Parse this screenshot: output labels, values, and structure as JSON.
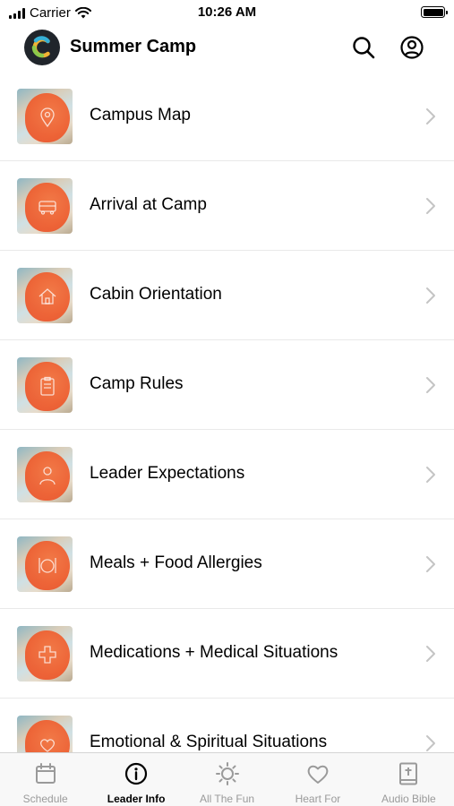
{
  "status_bar": {
    "carrier": "Carrier",
    "time": "10:26 AM"
  },
  "header": {
    "title": "Summer Camp",
    "search_icon": "search-icon",
    "profile_icon": "profile-icon"
  },
  "list": [
    {
      "label": "Campus Map",
      "icon": "map-pin-icon"
    },
    {
      "label": "Arrival at Camp",
      "icon": "bus-icon"
    },
    {
      "label": "Cabin Orientation",
      "icon": "house-icon"
    },
    {
      "label": "Camp Rules",
      "icon": "clipboard-icon"
    },
    {
      "label": "Leader Expectations",
      "icon": "person-icon"
    },
    {
      "label": "Meals + Food Allergies",
      "icon": "utensils-icon"
    },
    {
      "label": "Medications + Medical Situations",
      "icon": "medical-cross-icon"
    },
    {
      "label": "Emotional & Spiritual Situations",
      "icon": "heart-hands-icon"
    }
  ],
  "tabs": [
    {
      "label": "Schedule",
      "icon": "calendar-icon",
      "active": false
    },
    {
      "label": "Leader Info",
      "icon": "info-icon",
      "active": true
    },
    {
      "label": "All The Fun",
      "icon": "sun-icon",
      "active": false
    },
    {
      "label": "Heart For",
      "icon": "heart-icon",
      "active": false
    },
    {
      "label": "Audio Bible",
      "icon": "bible-icon",
      "active": false
    }
  ],
  "colors": {
    "accent_orange": "#ee5b2c",
    "tab_inactive": "#9a9a9a",
    "tab_active": "#000000"
  }
}
